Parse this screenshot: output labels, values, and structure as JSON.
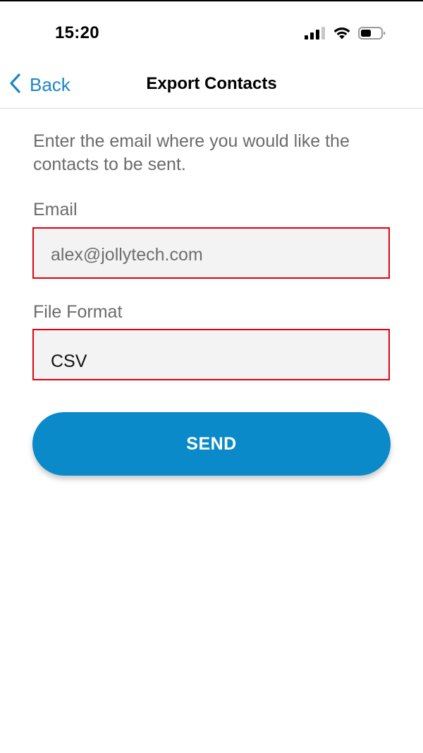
{
  "status_bar": {
    "time": "15:20",
    "icons": [
      "cellular-signal-icon",
      "wifi-icon",
      "battery-icon"
    ]
  },
  "nav": {
    "back_label": "Back",
    "title": "Export Contacts"
  },
  "form": {
    "instructions": "Enter the email where you would like the contacts to be sent.",
    "email_label": "Email",
    "email_value": "alex@jollytech.com",
    "format_label": "File Format",
    "format_value": "CSV",
    "send_label": "SEND"
  },
  "colors": {
    "accent": "#0a8ac8",
    "link": "#1b86c6",
    "highlight_border": "#e3000f",
    "field_background": "#f3f3f3"
  }
}
